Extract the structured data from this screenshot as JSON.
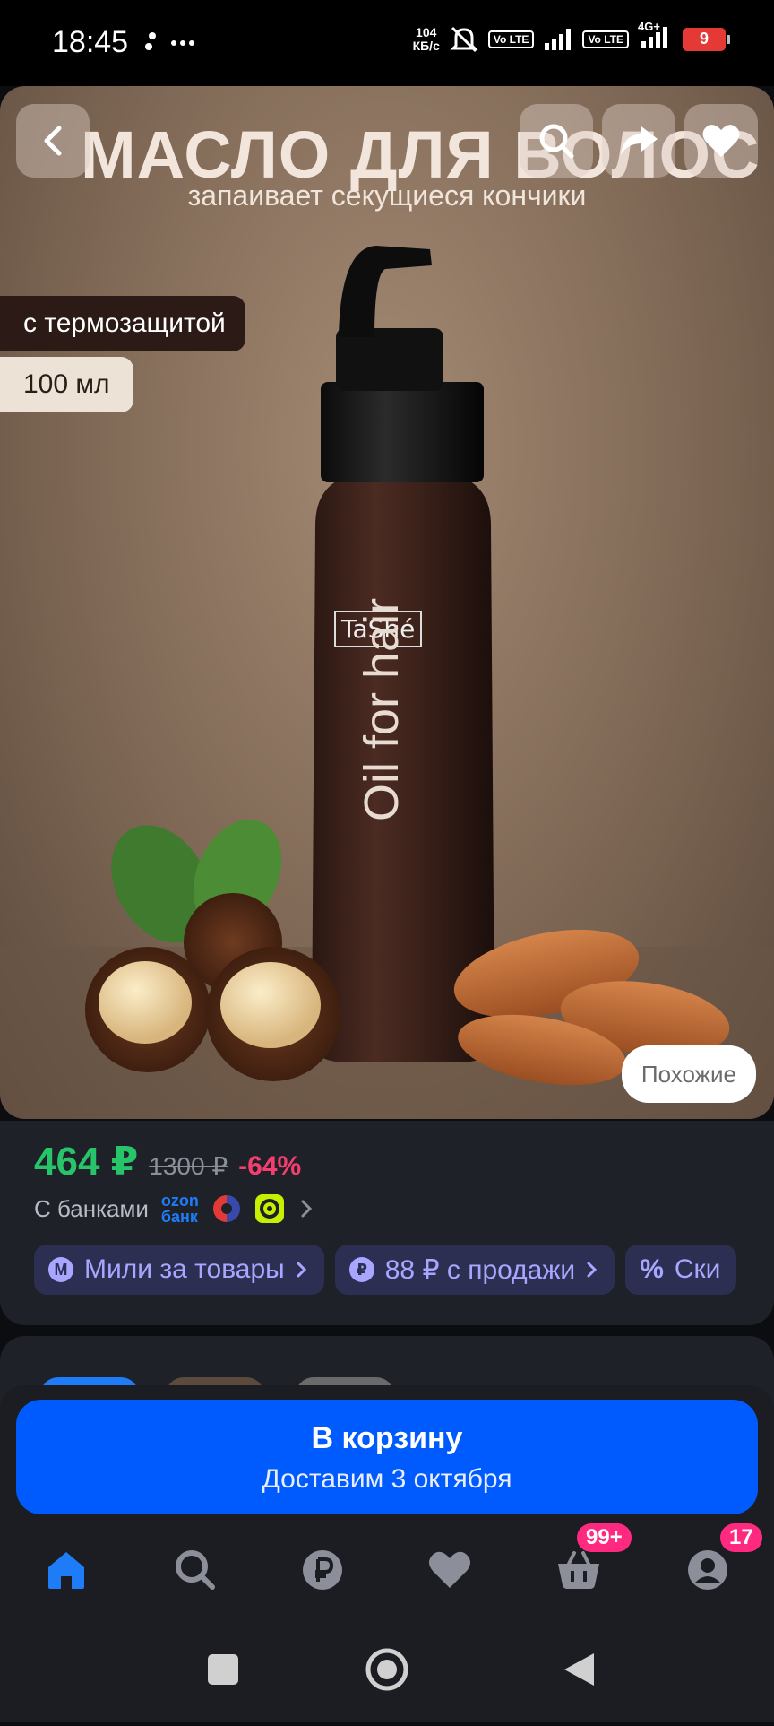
{
  "status_bar": {
    "time": "18:45",
    "net_speed_value": "104",
    "net_speed_unit": "КБ/с",
    "volte_1": "Vo LTE",
    "volte_2": "Vo LTE",
    "network": "4G+",
    "battery": "9"
  },
  "hero": {
    "title": "МАСЛО ДЛЯ ВОЛОС",
    "subtitle": "запаивает секущиеся кончики",
    "badge_thermal": "с термозащитой",
    "badge_volume": "100 мл",
    "similar_label": "Похожие",
    "icons": [
      "back-icon",
      "search-icon",
      "share-icon",
      "heart-icon"
    ]
  },
  "price": {
    "current": "464 ₽",
    "old": "1300 ₽",
    "discount": "-64%",
    "banks_label": "С банками",
    "ozon_bank_line1": "ozon",
    "ozon_bank_line2": "банк"
  },
  "chips": [
    {
      "icon": "М",
      "label": "Мили за товары"
    },
    {
      "icon": "₽",
      "label": "88 ₽ с продажи"
    },
    {
      "icon": "%",
      "label": "Ски"
    }
  ],
  "cart": {
    "label": "В корзину",
    "delivery": "Доставим 3 октября"
  },
  "tabs": {
    "cart_badge": "99+",
    "profile_badge": "17"
  },
  "colors": {
    "accent": "#005bff",
    "price_green": "#28c46a",
    "discount_pink": "#f43e6f",
    "chip_bg": "#2c2f52",
    "chip_text": "#a8a7ff"
  }
}
